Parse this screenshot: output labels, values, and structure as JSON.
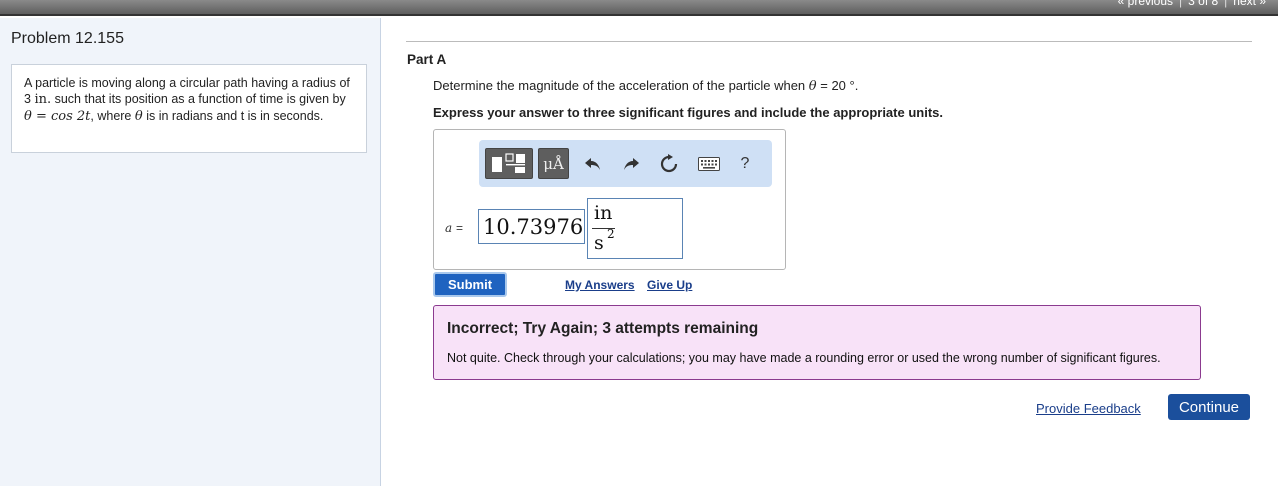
{
  "nav": {
    "previous": "« previous",
    "position": "3 of 8",
    "next": "next »",
    "separator": "|"
  },
  "problem": {
    "title": "Problem 12.155",
    "text_1": "A particle is moving along a circular path having a radius of 3",
    "unit_in": "in.",
    "text_2": "such that its position as a function of time is given by",
    "equation": "θ = cos 2t",
    "text_3": ", where",
    "theta": "θ",
    "text_4": "is in radians and t is in seconds."
  },
  "part": {
    "label": "Part A",
    "question_prefix": "Determine the magnitude of the acceleration of the particle when",
    "question_var": "θ",
    "question_suffix": "= 20 °.",
    "instruction": "Express your answer to three significant figures and include the appropriate units."
  },
  "toolbar": {
    "units_label": "μÅ",
    "undo_icon": "↶",
    "redo_icon": "↷",
    "reset_icon": "↻",
    "help_label": "?"
  },
  "answer": {
    "variable": "a",
    "equals": "=",
    "value": "10.73976",
    "unit_numerator": "in",
    "unit_denominator": "s",
    "unit_exponent": "2"
  },
  "actions": {
    "submit": "Submit",
    "my_answers": "My Answers",
    "give_up": "Give Up"
  },
  "feedback": {
    "title": "Incorrect; Try Again; 3 attempts remaining",
    "message": "Not quite. Check through your calculations; you may have made a rounding error or used the wrong number of significant figures."
  },
  "footer": {
    "provide_feedback": "Provide Feedback",
    "continue": "Continue"
  },
  "colors": {
    "submit_bg": "#1f63c0",
    "continue_bg": "#1b4f9c",
    "feedback_bg": "#f8e2f8",
    "feedback_border": "#8b3a8f",
    "toolbar_bg": "#cfe0f5"
  }
}
